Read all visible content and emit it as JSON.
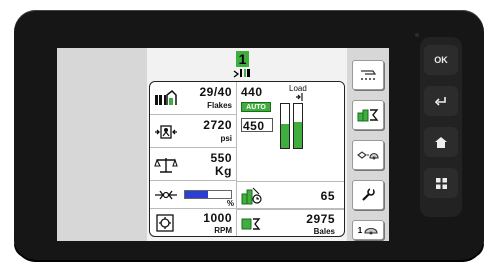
{
  "device": {
    "hardkeys": [
      {
        "id": "ok",
        "label": "OK"
      },
      {
        "id": "back",
        "icon": "return-icon"
      },
      {
        "id": "home",
        "icon": "home-icon"
      },
      {
        "id": "menu",
        "icon": "grid-icon"
      }
    ]
  },
  "header": {
    "bale_counter": "1",
    "hitch_icon": "hitch-indicator-icon"
  },
  "rows": {
    "flakes": {
      "value": "29/40",
      "unit": "Flakes",
      "icon": "flake-icon"
    },
    "pressure": {
      "value": "2720",
      "unit": "psi",
      "icon": "pressure-icon"
    },
    "weight": {
      "value": "550",
      "unit": "Kg",
      "icon": "scale-icon"
    },
    "moisture": {
      "unit": "%",
      "icon": "moisture-icon",
      "level": 0.5
    },
    "rpm": {
      "value": "1000",
      "unit": "RPM",
      "icon": "pto-icon"
    }
  },
  "load": {
    "label": "Load",
    "value": "440",
    "auto_label": "AUTO",
    "setpoint": "450",
    "left_fill": 0.55,
    "right_fill": 0.6
  },
  "rate": {
    "value": "65",
    "icon": "bale-rate-icon"
  },
  "bales": {
    "value": "2975",
    "unit": "Bales",
    "icon": "bale-total-icon"
  },
  "sidebar": {
    "buttons": [
      {
        "icon": "knotter-icon"
      },
      {
        "icon": "bale-sum-icon"
      },
      {
        "icon": "plunger-adjust-icon"
      },
      {
        "icon": "wrench-icon"
      },
      {
        "icon": "counter-one-icon",
        "label": "1"
      }
    ]
  },
  "colors": {
    "accent": "#3fae3f",
    "device": "#161616",
    "panel_bg": "#d7d7d7"
  }
}
